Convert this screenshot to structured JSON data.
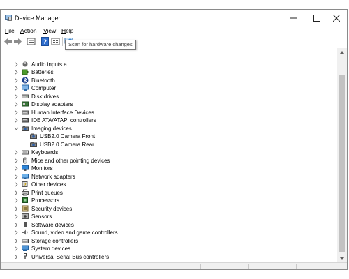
{
  "window": {
    "title": "Device Manager"
  },
  "menu": [
    {
      "accel": "F",
      "rest": "ile"
    },
    {
      "accel": "A",
      "rest": "ction"
    },
    {
      "accel": "V",
      "rest": "iew"
    },
    {
      "accel": "H",
      "rest": "elp"
    }
  ],
  "toolbar": {
    "icons": [
      "back-arrow-icon",
      "forward-arrow-icon",
      "properties-icon",
      "help-icon",
      "show-hidden-icon",
      "scan-hardware-icon"
    ],
    "tooltip": "Scan for hardware changes"
  },
  "tree": {
    "items": [
      {
        "label": "Audio inputs a",
        "icon": "audio-icon",
        "expanded": false
      },
      {
        "label": "Batteries",
        "icon": "battery-icon",
        "expanded": false
      },
      {
        "label": "Bluetooth",
        "icon": "bluetooth-icon",
        "expanded": false
      },
      {
        "label": "Computer",
        "icon": "computer-icon",
        "expanded": false
      },
      {
        "label": "Disk drives",
        "icon": "disk-icon",
        "expanded": false
      },
      {
        "label": "Display adapters",
        "icon": "display-adapter-icon",
        "expanded": false
      },
      {
        "label": "Human Interface Devices",
        "icon": "hid-icon",
        "expanded": false
      },
      {
        "label": "IDE ATA/ATAPI controllers",
        "icon": "ide-icon",
        "expanded": false
      },
      {
        "label": "Imaging devices",
        "icon": "camera-icon",
        "expanded": true,
        "children": [
          {
            "label": "USB2.0 Camera Front",
            "icon": "camera-icon"
          },
          {
            "label": "USB2.0 Camera Rear",
            "icon": "camera-icon"
          }
        ]
      },
      {
        "label": "Keyboards",
        "icon": "keyboard-icon",
        "expanded": false
      },
      {
        "label": "Mice and other pointing devices",
        "icon": "mouse-icon",
        "expanded": false
      },
      {
        "label": "Monitors",
        "icon": "monitor-icon",
        "expanded": false
      },
      {
        "label": "Network adapters",
        "icon": "network-icon",
        "expanded": false
      },
      {
        "label": "Other devices",
        "icon": "other-devices-icon",
        "expanded": false
      },
      {
        "label": "Print queues",
        "icon": "printer-icon",
        "expanded": false
      },
      {
        "label": "Processors",
        "icon": "processor-icon",
        "expanded": false
      },
      {
        "label": "Security devices",
        "icon": "security-icon",
        "expanded": false
      },
      {
        "label": "Sensors",
        "icon": "sensor-icon",
        "expanded": false
      },
      {
        "label": "Software devices",
        "icon": "software-icon",
        "expanded": false
      },
      {
        "label": "Sound, video and game controllers",
        "icon": "sound-icon",
        "expanded": false
      },
      {
        "label": "Storage controllers",
        "icon": "storage-icon",
        "expanded": false
      },
      {
        "label": "System devices",
        "icon": "system-icon",
        "expanded": false
      },
      {
        "label": "Universal Serial Bus controllers",
        "icon": "usb-icon",
        "expanded": false
      }
    ]
  },
  "colors": {
    "accent": "#1e73c8",
    "chevron": "#6f6f6f"
  }
}
